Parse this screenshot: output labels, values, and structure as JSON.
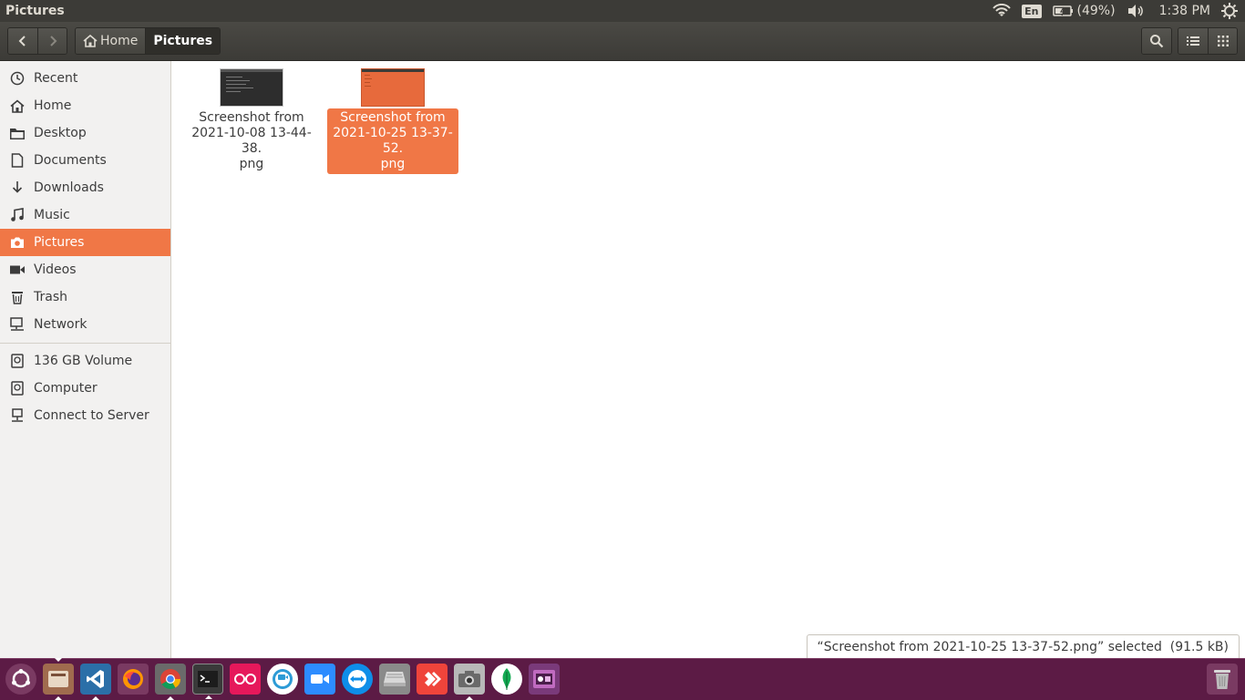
{
  "top_panel": {
    "app_title": "Pictures",
    "lang": "En",
    "battery": "(49%)",
    "time": "1:38 PM"
  },
  "headerbar": {
    "breadcrumbs": [
      "Home",
      "Pictures"
    ],
    "back_icon": "chevron-left-icon",
    "forward_icon": "chevron-right-icon",
    "search_icon": "search-icon",
    "list_view_icon": "list-view-icon",
    "grid_view_icon": "grid-view-icon"
  },
  "sidebar": {
    "items": [
      {
        "label": "Recent",
        "icon": "clock-icon"
      },
      {
        "label": "Home",
        "icon": "home-icon"
      },
      {
        "label": "Desktop",
        "icon": "folder-icon"
      },
      {
        "label": "Documents",
        "icon": "document-icon"
      },
      {
        "label": "Downloads",
        "icon": "download-icon"
      },
      {
        "label": "Music",
        "icon": "music-icon"
      },
      {
        "label": "Pictures",
        "icon": "camera-icon",
        "active": true
      },
      {
        "label": "Videos",
        "icon": "video-icon"
      },
      {
        "label": "Trash",
        "icon": "trash-icon"
      },
      {
        "label": "Network",
        "icon": "network-icon"
      }
    ],
    "devices": [
      {
        "label": "136 GB Volume",
        "icon": "drive-icon"
      },
      {
        "label": "Computer",
        "icon": "drive-icon"
      },
      {
        "label": "Connect to Server",
        "icon": "server-icon"
      }
    ]
  },
  "files": [
    {
      "name_line1": "Screenshot from",
      "name_line2": "2021-10-08 13-44-38.",
      "name_line3": "png",
      "selected": false
    },
    {
      "name_line1": "Screenshot from",
      "name_line2": "2021-10-25 13-37-52.",
      "name_line3": "png",
      "selected": true
    }
  ],
  "status": {
    "text": "“Screenshot from 2021-10-25 13-37-52.png” selected  (91.5 kB)"
  },
  "dock": {
    "apps": [
      "ubuntu-dash-icon",
      "files-icon",
      "vscode-icon",
      "firefox-icon",
      "chrome-icon",
      "terminal-icon",
      "flickr-icon",
      "ring-icon",
      "zoom-icon",
      "teamviewer-icon",
      "disks-icon",
      "anydesk-icon",
      "screenshot-icon",
      "mongodb-icon",
      "video-editor-icon"
    ],
    "trash": "trash-icon"
  },
  "colors": {
    "accent": "#f07746",
    "panel": "#3c3b37",
    "dock": "#5c1b45"
  }
}
